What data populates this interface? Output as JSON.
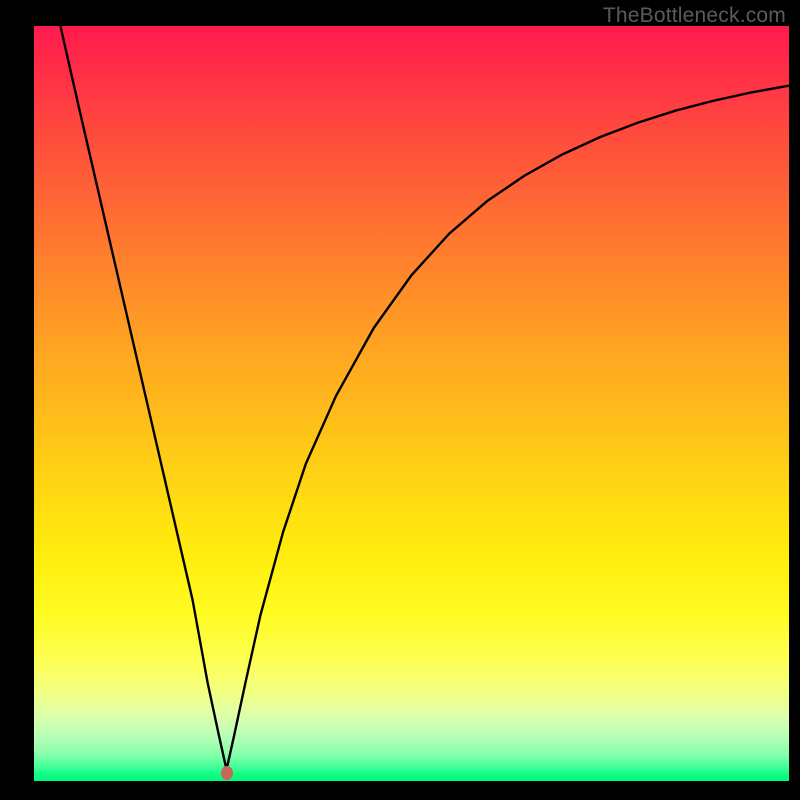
{
  "watermark": "TheBottleneck.com",
  "chart_data": {
    "type": "line",
    "title": "",
    "xlabel": "",
    "ylabel": "",
    "xlim": [
      0,
      100
    ],
    "ylim": [
      0,
      100
    ],
    "grid": false,
    "series": [
      {
        "name": "curve",
        "color": "#000000",
        "x": [
          3.5,
          6,
          9,
          12,
          15,
          18,
          21,
          23,
          24.5,
          25.5,
          26.5,
          28,
          30,
          33,
          36,
          40,
          45,
          50,
          55,
          60,
          65,
          70,
          75,
          80,
          85,
          90,
          95,
          100
        ],
        "values": [
          100,
          89,
          76,
          63,
          50,
          37,
          24,
          13,
          6,
          1.5,
          6,
          13,
          22,
          33,
          42,
          51,
          60,
          67,
          72.5,
          76.8,
          80.2,
          83,
          85.3,
          87.2,
          88.8,
          90.1,
          91.2,
          92.1
        ]
      }
    ],
    "marker": {
      "x": 25.5,
      "y": 1.0,
      "color": "#c9655a"
    },
    "background_gradient": {
      "type": "vertical",
      "stops": [
        {
          "pos": 0,
          "color": "#ff1a4d"
        },
        {
          "pos": 50,
          "color": "#ffb81c"
        },
        {
          "pos": 80,
          "color": "#fffb30"
        },
        {
          "pos": 100,
          "color": "#00f97c"
        }
      ]
    }
  }
}
